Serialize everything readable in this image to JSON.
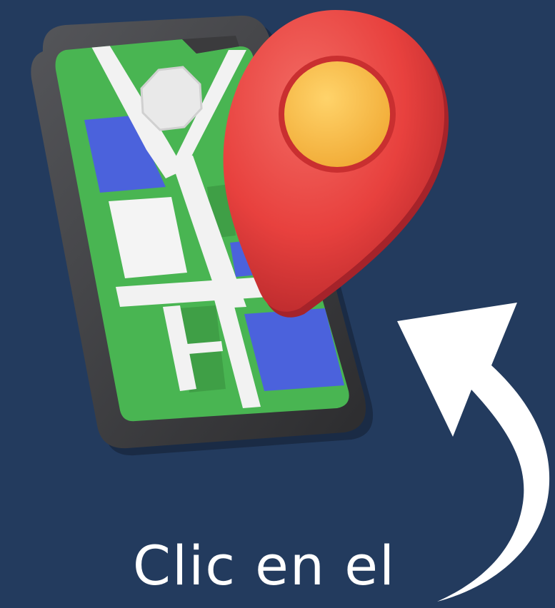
{
  "caption": {
    "text": "Clic en el"
  },
  "illustration": {
    "phone_icon": "smartphone-map-icon",
    "pin_icon": "location-pin-icon",
    "arrow_icon": "curved-arrow-up-icon"
  },
  "colors": {
    "background": "#233b5e",
    "phone_body": "#3b3b3d",
    "map_green": "#49b552",
    "map_block_blue": "#4b62dc",
    "road_white": "#f2f2f2",
    "pin_red": "#e8413e",
    "pin_center_yellow": "#f7c24f",
    "arrow_white": "#ffffff"
  }
}
